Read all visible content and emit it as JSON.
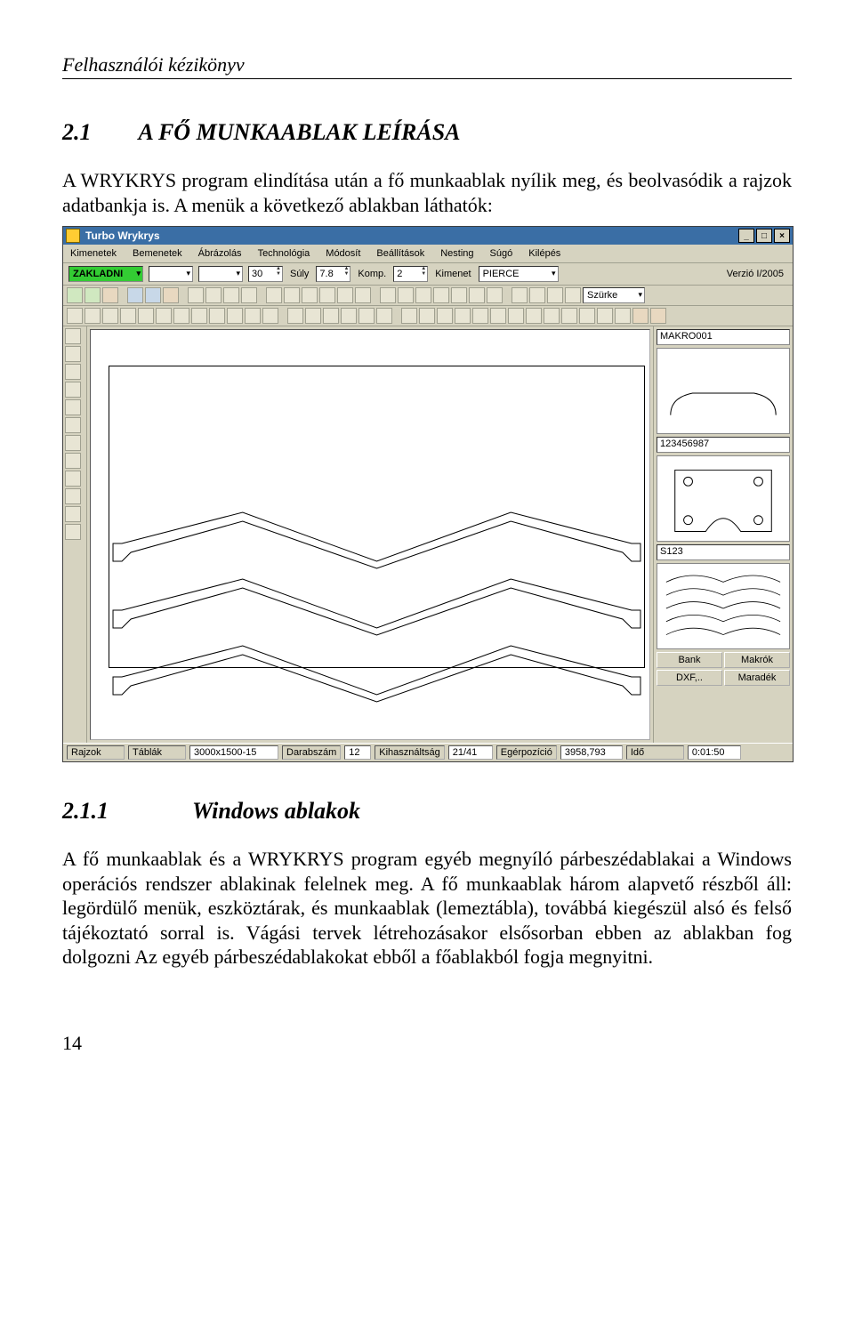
{
  "page": {
    "running_head": "Felhasználói kézikönyv",
    "page_number": "14"
  },
  "section": {
    "number": "2.1",
    "title": "A FŐ MUNKAABLAK LEÍRÁSA",
    "intro": "A WRYKRYS program elindítása után a fő munkaablak nyílik meg, és beolvasódik a rajzok adatbankja is. A menük a következő ablakban láthatók:"
  },
  "subsection": {
    "number": "2.1.1",
    "title": "Windows ablakok",
    "body": "A fő munkaablak és a WRYKRYS program egyéb megnyíló párbeszédablakai a Windows operációs rendszer ablakinak felelnek meg. A fő munkaablak három alapvető részből áll: legördülő menük, eszköztárak, és munkaablak (lemeztábla), továbbá kiegészül alsó és felső tájékoztató sorral is. Vágási tervek létrehozásakor elsősorban ebben az ablakban fog dolgozni Az egyéb párbeszédablakokat ebből a főablakból fogja megnyitni."
  },
  "app": {
    "title": "Turbo Wrykrys",
    "menus": [
      "Kimenetek",
      "Bemenetek",
      "Ábrázolás",
      "Technológia",
      "Módosít",
      "Beállítások",
      "Nesting",
      "Súgó",
      "Kilépés"
    ],
    "params": {
      "material": "ZAKLADNI",
      "qty": "30",
      "suly_label": "Súly",
      "suly": "7.8",
      "komp_label": "Komp.",
      "komp": "2",
      "kimenet_label": "Kimenet",
      "kimenet": "PIERCE",
      "version": "Verzió I/2005"
    },
    "toolbar_combo": "Szürke",
    "side": {
      "name1": "MAKRO001",
      "name2": "123456987",
      "name3": "S123",
      "buttons": [
        "Bank",
        "Makrók",
        "DXF,..",
        "Maradék"
      ]
    },
    "status": {
      "rajzok": "Rajzok",
      "tablak": "Táblák",
      "size": "3000x1500-15",
      "darab_label": "Darabszám",
      "darab": "12",
      "kihasz_label": "Kihasználtság",
      "kihasz": "21/41",
      "eger_label": "Egérpozíció",
      "eger": "3958,793",
      "ido_label": "Idő",
      "ido": "0:01:50"
    }
  }
}
